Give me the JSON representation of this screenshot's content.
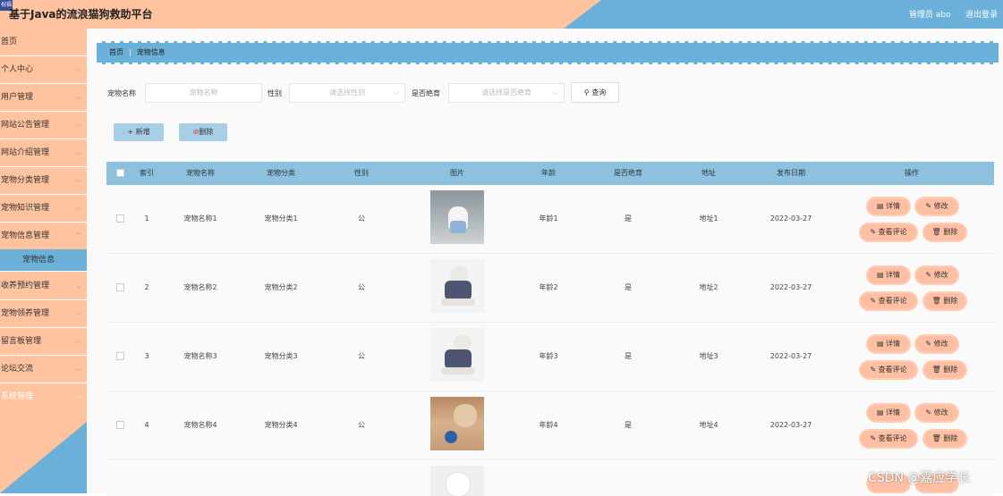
{
  "header": {
    "logo_text": "祝福",
    "title": "基于Java的流浪猫狗救助平台",
    "user": "管理员 abo",
    "logout": "退出登录"
  },
  "sidebar": {
    "items": [
      {
        "label": "首页"
      },
      {
        "label": "个人中心"
      },
      {
        "label": "用户管理"
      },
      {
        "label": "网站公告管理"
      },
      {
        "label": "网站介绍管理"
      },
      {
        "label": "宠物分类管理"
      },
      {
        "label": "宠物知识管理"
      },
      {
        "label": "宠物信息管理"
      },
      {
        "label": "宠物信息"
      },
      {
        "label": "收养预约管理"
      },
      {
        "label": "宠物领养管理"
      },
      {
        "label": "留言板管理"
      },
      {
        "label": "论坛交流"
      },
      {
        "label": "系统管理"
      }
    ]
  },
  "breadcrumb": {
    "home": "首页",
    "sep": "|",
    "current": "宠物信息"
  },
  "search": {
    "name_label": "宠物名称",
    "name_placeholder": "宠物名称",
    "sex_label": "性别",
    "sex_placeholder": "请选择性别",
    "neutered_label": "是否绝育",
    "neutered_placeholder": "请选择是否绝育",
    "query": "查询"
  },
  "actions": {
    "add": "新增",
    "delete": "删除"
  },
  "table": {
    "headers": [
      "索引",
      "宠物名称",
      "宠物分类",
      "性别",
      "图片",
      "年龄",
      "是否绝育",
      "地址",
      "发布日期",
      "操作"
    ],
    "rows": [
      {
        "index": "1",
        "name": "宠物名称1",
        "category": "宠物分类1",
        "sex": "公",
        "age": "年龄1",
        "neutered": "是",
        "address": "地址1",
        "date": "2022-03-27"
      },
      {
        "index": "2",
        "name": "宠物名称2",
        "category": "宠物分类2",
        "sex": "公",
        "age": "年龄2",
        "neutered": "是",
        "address": "地址2",
        "date": "2022-03-27"
      },
      {
        "index": "3",
        "name": "宠物名称3",
        "category": "宠物分类3",
        "sex": "公",
        "age": "年龄3",
        "neutered": "是",
        "address": "地址3",
        "date": "2022-03-27"
      },
      {
        "index": "4",
        "name": "宠物名称4",
        "category": "宠物分类4",
        "sex": "公",
        "age": "年龄4",
        "neutered": "是",
        "address": "地址4",
        "date": "2022-03-27"
      }
    ],
    "ops": {
      "detail": "详情",
      "edit": "修改",
      "comments": "查看评论",
      "delete": "删除"
    }
  },
  "watermark": "CSDN @嘉应学长",
  "colors": {
    "peach": "#ffc3a0",
    "blue": "#6ab0d8",
    "button_peach": "#ffbfa3",
    "table_header": "#8cc2e0"
  }
}
